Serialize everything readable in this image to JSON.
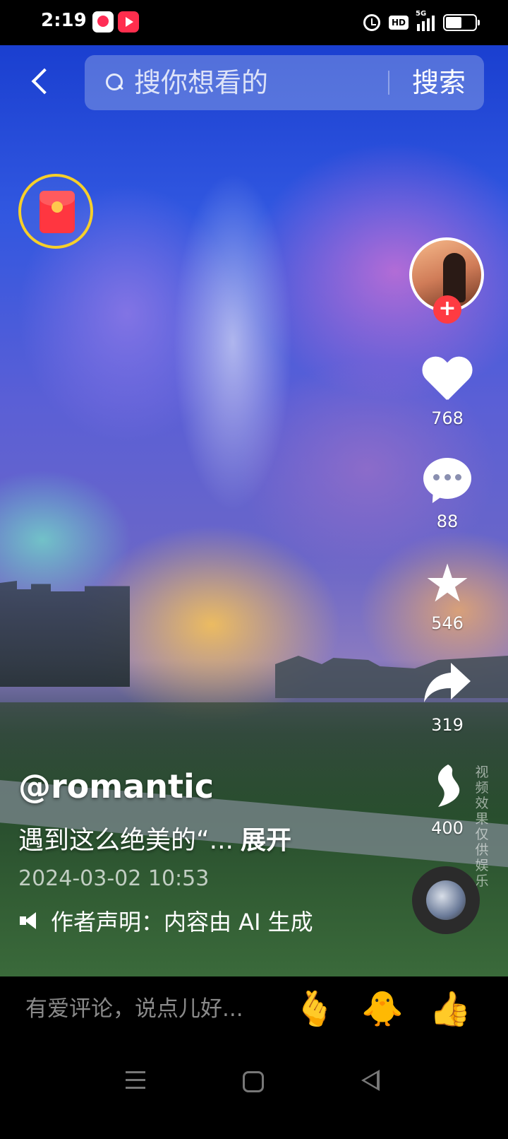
{
  "status_bar": {
    "time": "2:19",
    "hd_label": "HD",
    "network_label": "5G",
    "battery_percent": 55
  },
  "search": {
    "placeholder": "搜你想看的",
    "button_label": "搜索"
  },
  "actions": {
    "likes": "768",
    "comments": "88",
    "favorites": "546",
    "shares": "319",
    "recommends": "400"
  },
  "follow_symbol": "+",
  "vertical_note": "视频效果仅供娱乐",
  "post": {
    "author": "@romantic",
    "description": "遇到这么绝美的“...",
    "expand_label": "展开",
    "date": "2024-03-02 10:53",
    "declaration": "作者声明：内容由 AI 生成"
  },
  "comment_bar": {
    "placeholder": "有爱评论，说点儿好...",
    "emojis": [
      "🫰",
      "🐥",
      "👍"
    ]
  },
  "colors": {
    "accent_red": "#fe3b42",
    "redpacket_ring": "#f6cf2a"
  },
  "icons": [
    "back-icon",
    "search-icon",
    "red-packet-icon",
    "heart-icon",
    "comment-icon",
    "star-icon",
    "share-icon",
    "recommend-icon",
    "music-disc-icon",
    "speaker-icon"
  ]
}
